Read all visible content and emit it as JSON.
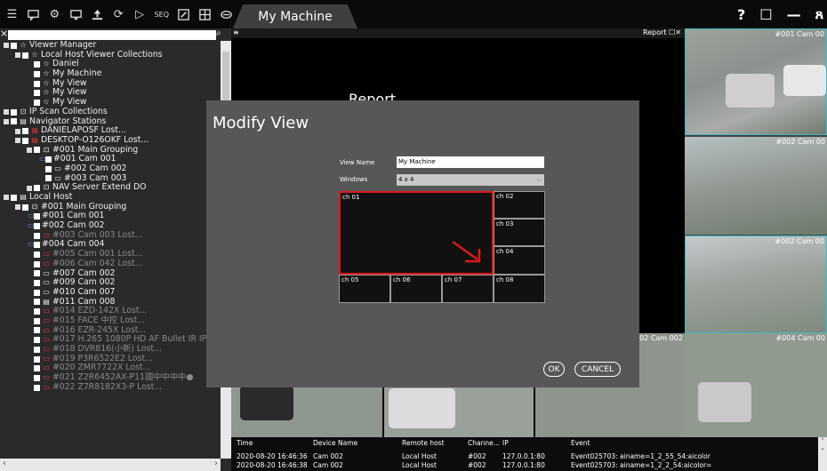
{
  "window": {
    "title": "My Machine",
    "help": "?",
    "minimize": "—",
    "seq": "SEQ"
  },
  "search": {
    "value": "",
    "clear": "×",
    "ok": "✓"
  },
  "tree": [
    {
      "label": "Viewer Manager",
      "depth": 0,
      "exp": true,
      "icon": "☆",
      "lost": false
    },
    {
      "label": "Local Host Viewer Collections",
      "depth": 1,
      "exp": true,
      "icon": "☆",
      "lost": false
    },
    {
      "label": "Daniel",
      "depth": 2,
      "exp": false,
      "icon": "☆",
      "lost": false
    },
    {
      "label": "My Machine",
      "depth": 2,
      "exp": false,
      "icon": "☆",
      "lost": false
    },
    {
      "label": "My View",
      "depth": 2,
      "exp": false,
      "icon": "☆",
      "lost": false
    },
    {
      "label": "My View",
      "depth": 2,
      "exp": false,
      "icon": "☆",
      "lost": false
    },
    {
      "label": "My View",
      "depth": 2,
      "exp": false,
      "icon": "☆",
      "lost": false
    },
    {
      "label": "IP Scan Collections",
      "depth": 0,
      "exp": true,
      "icon": "⊡",
      "lost": false
    },
    {
      "label": "Navigator Stations",
      "depth": 0,
      "exp": true,
      "icon": "▤",
      "lost": false
    },
    {
      "label": "DANIELAPOSF Lost...",
      "depth": 1,
      "exp": true,
      "icon": "▤",
      "lost": false,
      "red": true
    },
    {
      "label": "DESKTOP-O126OKF Lost...",
      "depth": 1,
      "exp": true,
      "icon": "▤",
      "lost": false,
      "red": true
    },
    {
      "label": "#001 Main Grouping",
      "depth": 2,
      "exp": true,
      "icon": "⊡",
      "lost": false
    },
    {
      "label": "#001 Cam 001",
      "depth": 3,
      "exp": false,
      "icon": "▭",
      "lost": false,
      "cam": true
    },
    {
      "label": "#002 Cam 002",
      "depth": 3,
      "exp": false,
      "icon": "▭",
      "lost": false
    },
    {
      "label": "#003 Cam 003",
      "depth": 3,
      "exp": false,
      "icon": "▭",
      "lost": false
    },
    {
      "label": "NAV Server Extend DO",
      "depth": 2,
      "exp": true,
      "icon": "⊡",
      "lost": false
    },
    {
      "label": "Local Host",
      "depth": 0,
      "exp": true,
      "icon": "▤",
      "lost": false
    },
    {
      "label": "#001 Main Grouping",
      "depth": 1,
      "exp": true,
      "icon": "⊡",
      "lost": false
    },
    {
      "label": "#001 Cam 001",
      "depth": 2,
      "exp": false,
      "icon": "▭",
      "lost": false,
      "cam": true
    },
    {
      "label": "#002 Cam 002",
      "depth": 2,
      "exp": false,
      "icon": "▭",
      "lost": false,
      "cam": true
    },
    {
      "label": "#003 Cam 003 Lost...",
      "depth": 2,
      "exp": false,
      "icon": "▭",
      "lost": true,
      "red": true
    },
    {
      "label": "#004 Cam 004",
      "depth": 2,
      "exp": false,
      "icon": "▭",
      "lost": false,
      "cam": true
    },
    {
      "label": "#005 Cam 001 Lost...",
      "depth": 2,
      "exp": false,
      "icon": "▭",
      "lost": true,
      "red": true
    },
    {
      "label": "#006 Cam 042 Lost...",
      "depth": 2,
      "exp": false,
      "icon": "▭",
      "lost": true,
      "red": true
    },
    {
      "label": "#007 Cam 002",
      "depth": 2,
      "exp": false,
      "icon": "▭",
      "lost": false
    },
    {
      "label": "#009 Cam 002",
      "depth": 2,
      "exp": false,
      "icon": "▭",
      "lost": false
    },
    {
      "label": "#010 Cam 007",
      "depth": 2,
      "exp": false,
      "icon": "▭",
      "lost": false
    },
    {
      "label": "#011 Cam 008",
      "depth": 2,
      "exp": false,
      "icon": "▤",
      "lost": false
    },
    {
      "label": "#014 EZD-142X Lost...",
      "depth": 2,
      "exp": false,
      "icon": "▭",
      "lost": true,
      "red": true
    },
    {
      "label": "#015 FACE 中控 Lost...",
      "depth": 2,
      "exp": false,
      "icon": "▭",
      "lost": true,
      "red": true
    },
    {
      "label": "#016 EZR-245X Lost...",
      "depth": 2,
      "exp": false,
      "icon": "▭",
      "lost": true,
      "red": true
    },
    {
      "label": "#017 H.265 1080P HD AF Bullet IR IP",
      "depth": 2,
      "exp": false,
      "icon": "▭",
      "lost": true,
      "red": true
    },
    {
      "label": "#018 DVR816(小新) Lost...",
      "depth": 2,
      "exp": false,
      "icon": "▭",
      "lost": true,
      "red": true
    },
    {
      "label": "#019 P3R6522E2 Lost...",
      "depth": 2,
      "exp": false,
      "icon": "▭",
      "lost": true,
      "red": true
    },
    {
      "label": "#020 ZMR7722X Lost...",
      "depth": 2,
      "exp": false,
      "icon": "▭",
      "lost": true,
      "red": true
    },
    {
      "label": "#021 Z2R6452AX-P11國中中中中●",
      "depth": 2,
      "exp": false,
      "icon": "▭",
      "lost": true,
      "red": true
    },
    {
      "label": "#022 Z7R8182X3-P Lost...",
      "depth": 2,
      "exp": false,
      "icon": "▭",
      "lost": true,
      "red": true
    }
  ],
  "report": {
    "label": "Report",
    "title": "Report"
  },
  "cams": {
    "c1": "#001 Cam 00",
    "c2": "#002 Cam 00",
    "c3": "#002 Cam 00",
    "c4": "#004 Cam 00",
    "c5": "02 Cam 002"
  },
  "modal": {
    "title": "Modify View",
    "view_name_label": "View Name",
    "view_name_value": "My Machine",
    "windows_label": "Windows",
    "windows_value": "4 x 4",
    "cells": [
      "ch 01",
      "ch 02",
      "ch 03",
      "ch 04",
      "ch 05",
      "ch 06",
      "ch 07",
      "ch 08"
    ],
    "ok": "OK",
    "cancel": "CANCEL"
  },
  "log": {
    "headers": [
      "Time",
      "Device Name",
      "Remote host",
      "Channe...",
      "IP",
      "Event"
    ],
    "rows": [
      [
        "2020-08-20 16:46:36",
        "Cam 002",
        "Local Host",
        "#002",
        "127.0.0.1:80",
        "Event025703: ainame=1_2_55_54:aicolor"
      ],
      [
        "2020-08-20 16:46:38",
        "Cam 002",
        "Local Host",
        "#002",
        "127.0.0.1:80",
        "Event025703: ainame=1_2_2_54:aicolor="
      ]
    ]
  },
  "colors": {
    "accent_red": "#e01818",
    "cam_blue": "#5a86ff",
    "selected_cyan": "#3fb8c8"
  }
}
